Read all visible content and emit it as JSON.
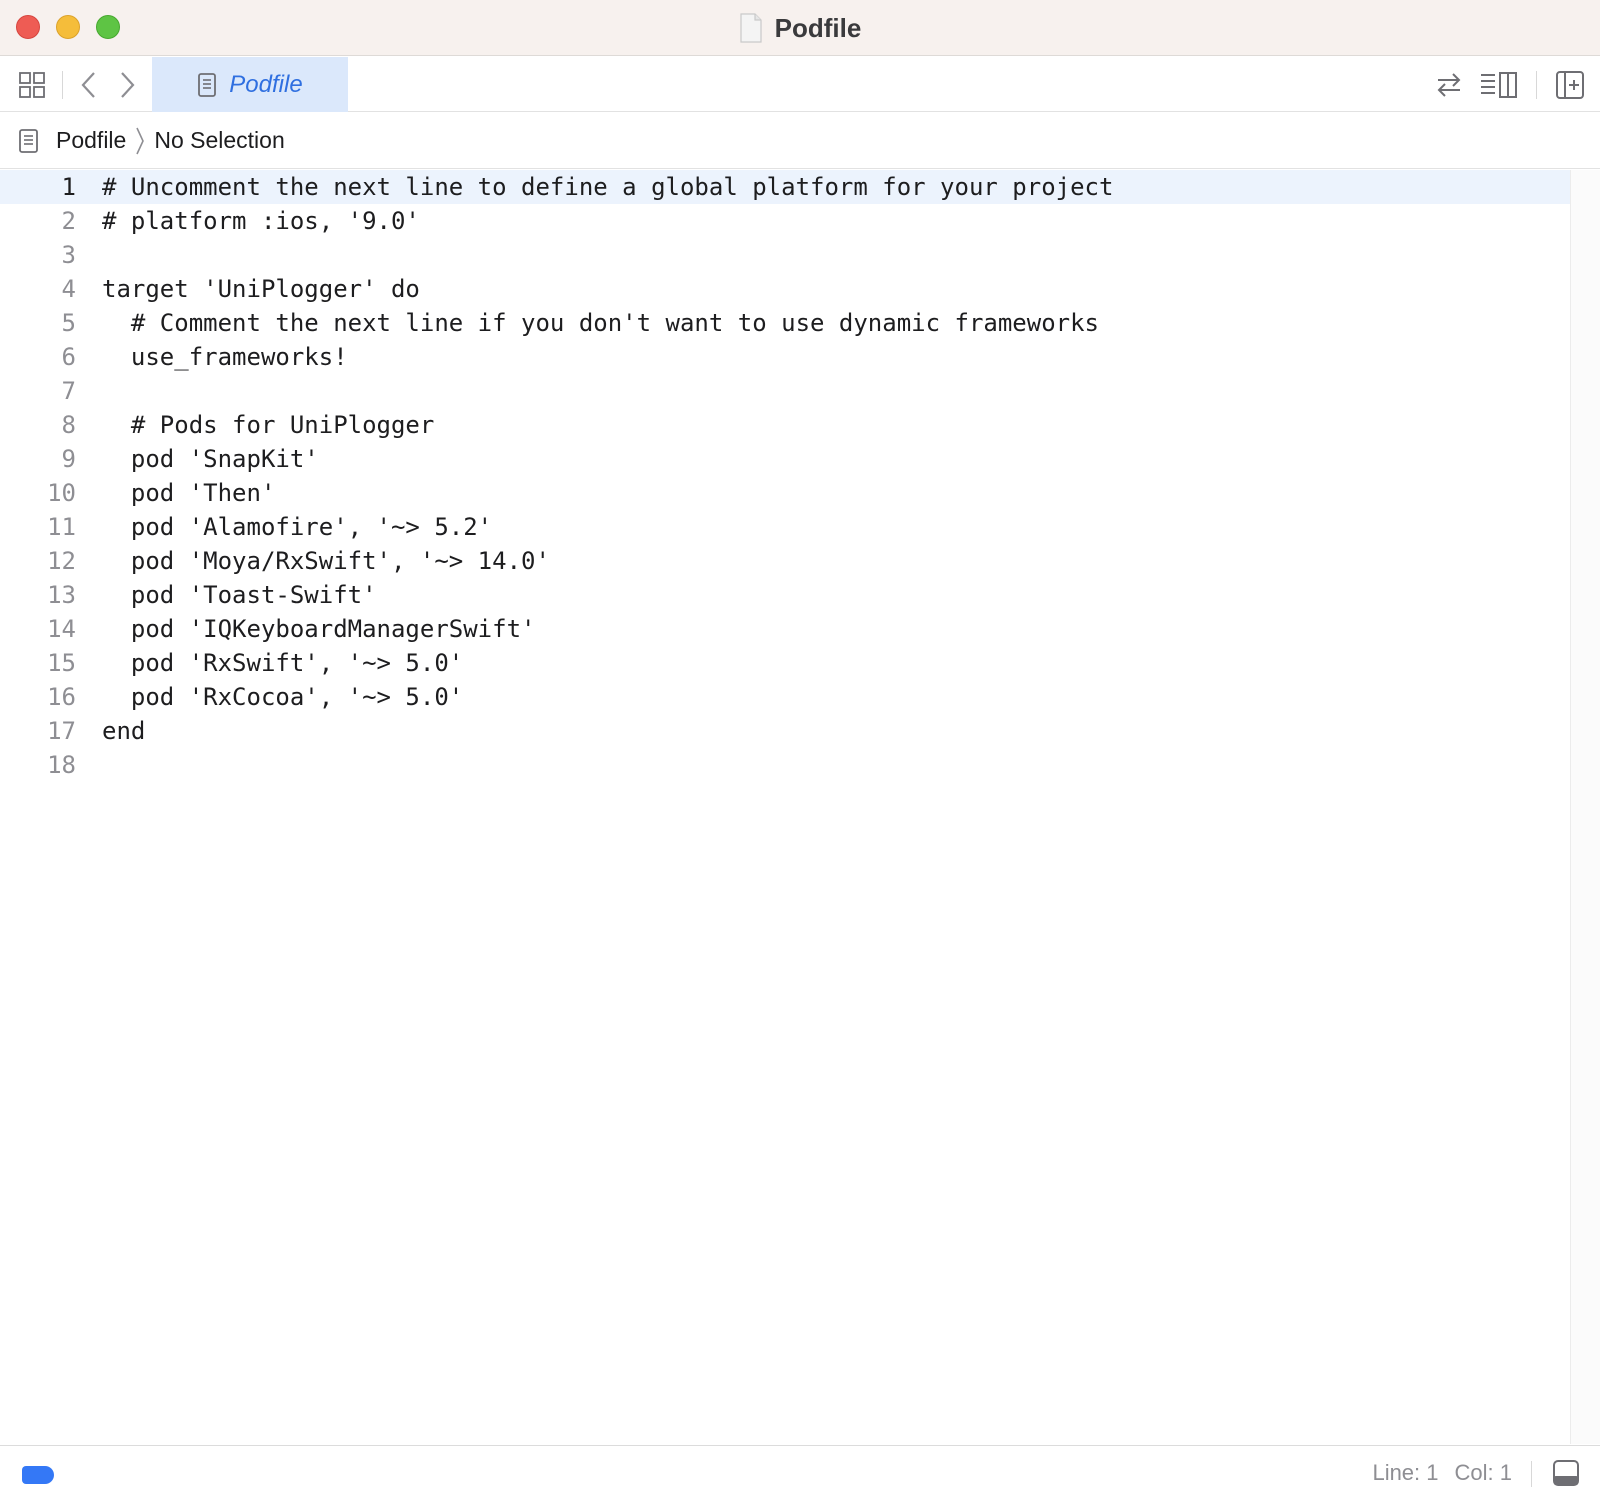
{
  "window": {
    "title": "Podfile",
    "title_icon": "document-icon"
  },
  "toolbar": {
    "grid_icon": "related-items-grid-icon",
    "back_icon": "chevron-left-icon",
    "forward_icon": "chevron-right-icon",
    "tab_label": "Podfile",
    "tab_icon": "text-document-icon",
    "swap_icon": "arrows-swap-icon",
    "inspector_icon": "editor-options-icon",
    "add_editor_icon": "add-editor-icon"
  },
  "jumpbar": {
    "file": "Podfile",
    "selection": "No Selection"
  },
  "editor": {
    "current_line": 1,
    "lines": [
      {
        "n": "1",
        "text": "# Uncomment the next line to define a global platform for your project"
      },
      {
        "n": "2",
        "text": "# platform :ios, '9.0'"
      },
      {
        "n": "3",
        "text": ""
      },
      {
        "n": "4",
        "text": "target 'UniPlogger' do"
      },
      {
        "n": "5",
        "text": "  # Comment the next line if you don't want to use dynamic frameworks"
      },
      {
        "n": "6",
        "text": "  use_frameworks!"
      },
      {
        "n": "7",
        "text": ""
      },
      {
        "n": "8",
        "text": "  # Pods for UniPlogger"
      },
      {
        "n": "9",
        "text": "  pod 'SnapKit'"
      },
      {
        "n": "10",
        "text": "  pod 'Then'"
      },
      {
        "n": "11",
        "text": "  pod 'Alamofire', '~> 5.2'"
      },
      {
        "n": "12",
        "text": "  pod 'Moya/RxSwift', '~> 14.0'"
      },
      {
        "n": "13",
        "text": "  pod 'Toast-Swift'"
      },
      {
        "n": "14",
        "text": "  pod 'IQKeyboardManagerSwift'"
      },
      {
        "n": "15",
        "text": "  pod 'RxSwift', '~> 5.0'"
      },
      {
        "n": "16",
        "text": "  pod 'RxCocoa', '~> 5.0'"
      },
      {
        "n": "17",
        "text": "end"
      },
      {
        "n": "18",
        "text": ""
      }
    ]
  },
  "statusbar": {
    "line": "Line: 1",
    "col": "Col: 1",
    "tag_color": "#3478f6"
  },
  "colors": {
    "accent": "#2f6fe0",
    "tab_bg": "#dbe8fb",
    "current_line_bg": "#ecf3fd"
  }
}
